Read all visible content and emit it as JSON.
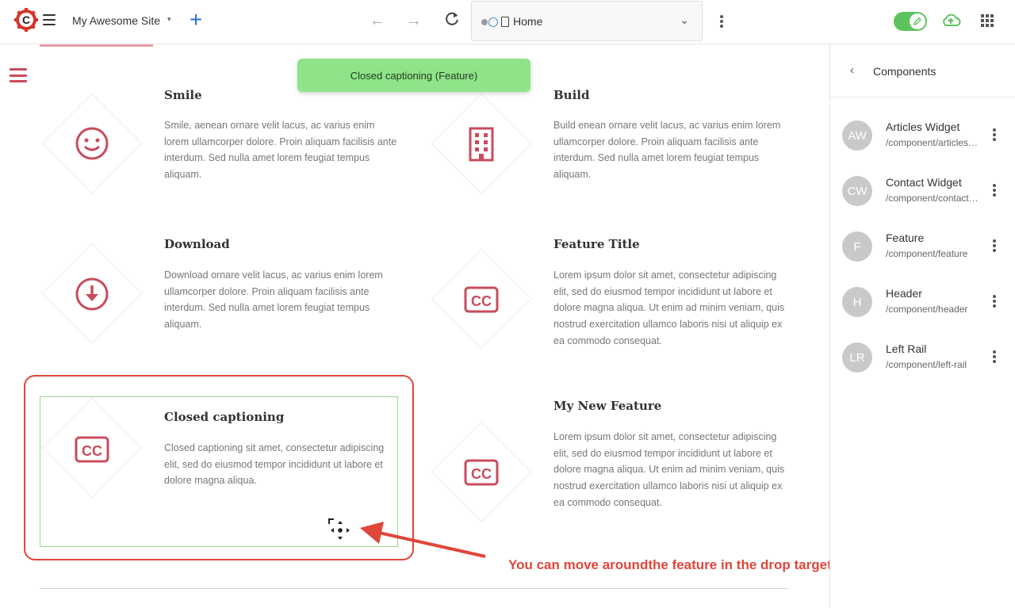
{
  "header": {
    "site_name": "My Awesome Site",
    "site_caret": "▾",
    "add_label": "+",
    "back_arrow": "←",
    "forward_arrow": "→",
    "address_text": "Home",
    "address_chevron": "⌄"
  },
  "toast": {
    "text": "Closed captioning (Feature)"
  },
  "features": [
    {
      "title": "Smile",
      "description": "Smile, aenean ornare velit lacus, ac varius enim lorem ullamcorper dolore. Proin aliquam facilisis ante interdum. Sed nulla amet lorem feugiat tempus aliquam.",
      "icon": "smile-icon"
    },
    {
      "title": "Build",
      "description": "Build enean ornare velit lacus, ac varius enim lorem ullamcorper dolore. Proin aliquam facilisis ante interdum. Sed nulla amet lorem feugiat tempus aliquam.",
      "icon": "building-icon"
    },
    {
      "title": "Download",
      "description": "Download ornare velit lacus, ac varius enim lorem ullamcorper dolore. Proin aliquam facilisis ante interdum. Sed nulla amet lorem feugiat tempus aliquam.",
      "icon": "download-icon"
    },
    {
      "title": "Feature Title",
      "description": "Lorem ipsum dolor sit amet, consectetur adipiscing elit, sed do eiusmod tempor incididunt ut labore et dolore magna aliqua. Ut enim ad minim veniam, quis nostrud exercitation ullamco laboris nisi ut aliquip ex ea commodo consequat.",
      "icon": "closed-captioning-icon"
    },
    {
      "title": "Closed captioning",
      "description": "Closed captioning sit amet, consectetur adipiscing elit, sed do eiusmod tempor incididunt ut labore et dolore magna aliqua.",
      "icon": "closed-captioning-icon"
    },
    {
      "title": "My New Feature",
      "description": "Lorem ipsum dolor sit amet, consectetur adipiscing elit, sed do eiusmod tempor incididunt ut labore et dolore magna aliqua. Ut enim ad minim veniam, quis nostrud exercitation ullamco laboris nisi ut aliquip ex ea commodo consequat.",
      "icon": "closed-captioning-icon"
    }
  ],
  "annotation": {
    "text": "You can move aroundthe feature in the drop target area"
  },
  "panel": {
    "back_label": "‹",
    "title": "Components",
    "items": [
      {
        "initials": "AW",
        "name": "Articles Widget",
        "path": "/component/articles-widget"
      },
      {
        "initials": "CW",
        "name": "Contact Widget",
        "path": "/component/contact-widget"
      },
      {
        "initials": "F",
        "name": "Feature",
        "path": "/component/feature"
      },
      {
        "initials": "H",
        "name": "Header",
        "path": "/component/header"
      },
      {
        "initials": "LR",
        "name": "Left Rail",
        "path": "/component/left-rail"
      }
    ]
  },
  "colors": {
    "accent_red": "#c94c5c",
    "brand_blue": "#2d6fd6",
    "toggle_green": "#5cc45c",
    "toast_green": "#8fe48a",
    "annotation_red": "#e0463a"
  }
}
